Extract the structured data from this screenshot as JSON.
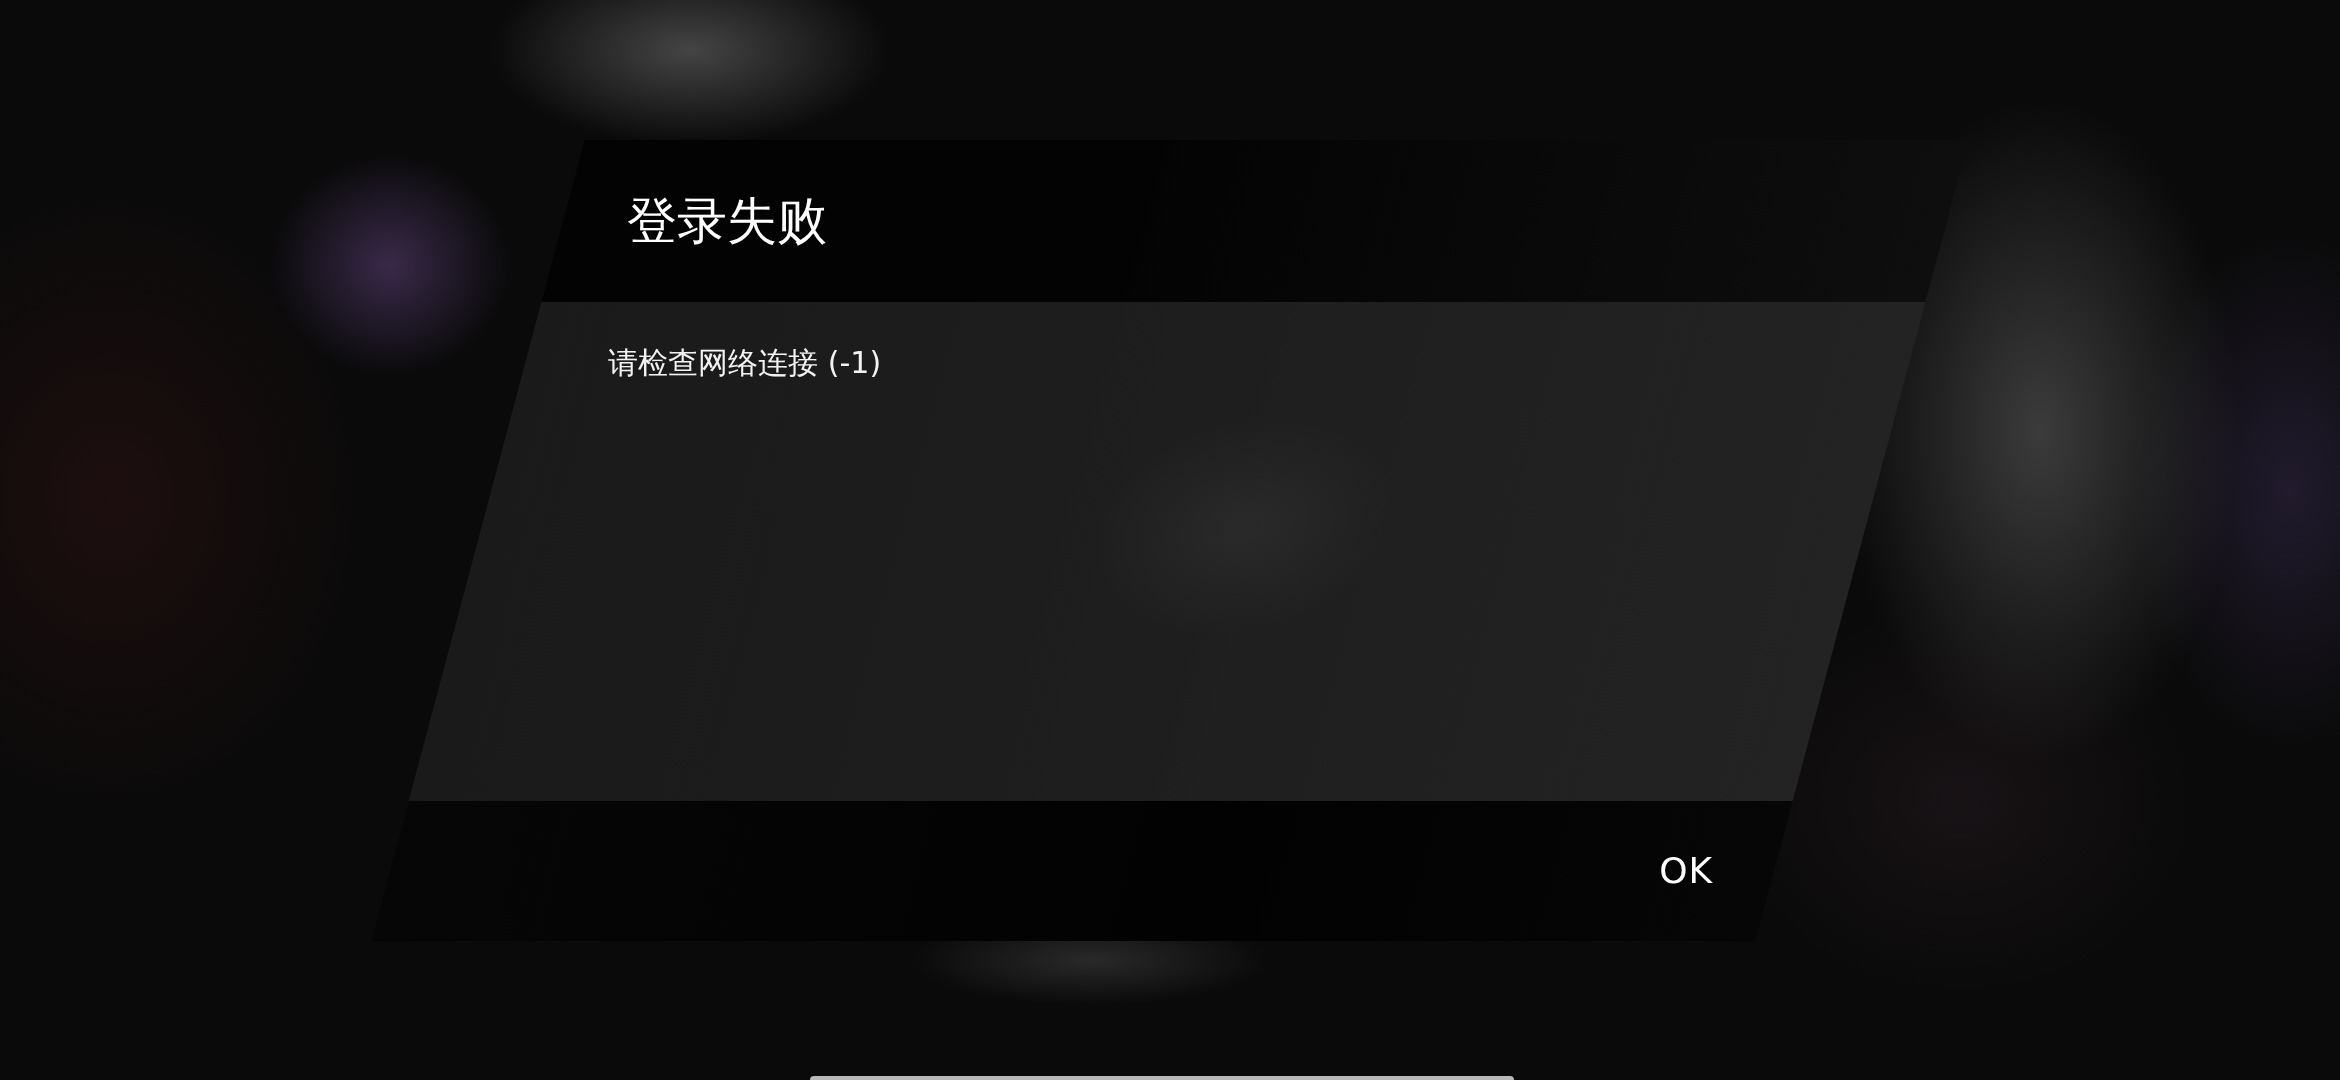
{
  "dialog": {
    "title": "登录失败",
    "message": "请检查网络连接 (-1)",
    "buttons": [
      "OK"
    ]
  }
}
